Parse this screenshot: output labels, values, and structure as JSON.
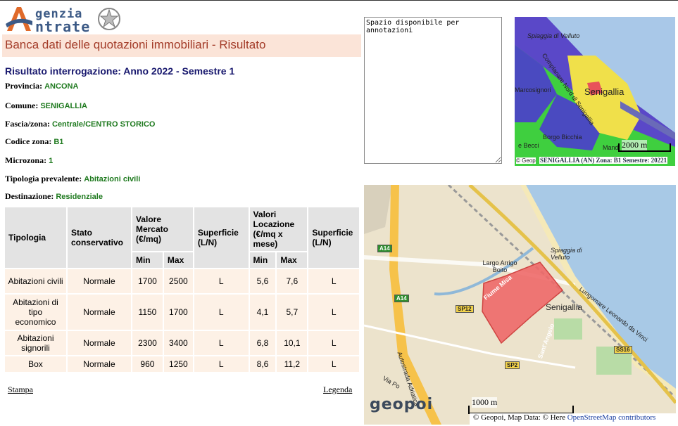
{
  "logo": {
    "line1": "genzia",
    "line2": "ntrate"
  },
  "page_title": "Banca dati delle quotazioni immobiliari - Risultato",
  "result_title": "Risultato interrogazione: Anno 2022 - Semestre 1",
  "info": {
    "provincia": {
      "label": "Provincia:",
      "value": "ANCONA"
    },
    "comune": {
      "label": "Comune:",
      "value": "SENIGALLIA"
    },
    "fascia": {
      "label": "Fascia/zona:",
      "value": "Centrale/CENTRO STORICO"
    },
    "codice": {
      "label": "Codice zona:",
      "value": "B1"
    },
    "microzona": {
      "label": "Microzona:",
      "value": "1"
    },
    "tipologia": {
      "label": "Tipologia prevalente:",
      "value": "Abitazioni civili"
    },
    "destinazione": {
      "label": "Destinazione:",
      "value": "Residenziale"
    }
  },
  "table": {
    "headers": {
      "tipologia": "Tipologia",
      "stato": "Stato conservativo",
      "valore": "Valore Mercato (€/mq)",
      "superficie": "Superficie (L/N)",
      "locazione": "Valori Locazione (€/mq x mese)",
      "superficie2": "Superficie (L/N)",
      "min": "Min",
      "max": "Max",
      "min2": "Min",
      "max2": "Max"
    },
    "rows": [
      [
        "Abitazioni civili",
        "Normale",
        "1700",
        "2500",
        "L",
        "5,6",
        "7,6",
        "L"
      ],
      [
        "Abitazioni di tipo economico",
        "Normale",
        "1150",
        "1700",
        "L",
        "4,1",
        "5,7",
        "L"
      ],
      [
        "Abitazioni signorili",
        "Normale",
        "2300",
        "3400",
        "L",
        "6,8",
        "10,1",
        "L"
      ],
      [
        "Box",
        "Normale",
        "960",
        "1250",
        "L",
        "8,6",
        "11,2",
        "L"
      ]
    ]
  },
  "links": {
    "stampa": "Stampa",
    "legenda": "Legenda"
  },
  "notes": {
    "value": "Spazio disponibile per\nannotazioni"
  },
  "map_small": {
    "labels": {
      "spiaggia": "Spiaggia di Velluto",
      "complanare": "Complanare Nord di Senigallia",
      "marcosignori": "Marcosignori",
      "senigallia": "Senigallia",
      "borgo": "Borgo Bicchia",
      "becci": "e Becci",
      "mand": "Mand",
      "scale": "2000 m",
      "geop": "© Geop",
      "caption": "SENIGALLIA (AN) Zona: B1 Semestre: 20221"
    }
  },
  "map_big": {
    "labels": {
      "largo": "Largo Arrigo Boito",
      "spiaggia": "Spiaggia di Velluto",
      "fiume": "Fiume Misa",
      "senigallia": "Senigallia",
      "lungomare": "Lungomare Leonardo da Vinci",
      "autostrada": "Autostrada Adriatica",
      "via_po": "Via Po",
      "santangelo": "Sant'Angelo",
      "a14a": "A14",
      "a14b": "A14",
      "sp12": "SP12",
      "ss16": "SS16",
      "sp2": "SP2",
      "scale": "1000 m",
      "brand": "geopoi",
      "attribution": "© Geopoi, Map Data: © Here",
      "osm": "OpenStreetMap contributors"
    }
  },
  "colors": {
    "brand_red": "#a33b28",
    "title_blue": "#18186e",
    "value_green": "#1f7a1f",
    "zone_red": "#e8525a"
  }
}
